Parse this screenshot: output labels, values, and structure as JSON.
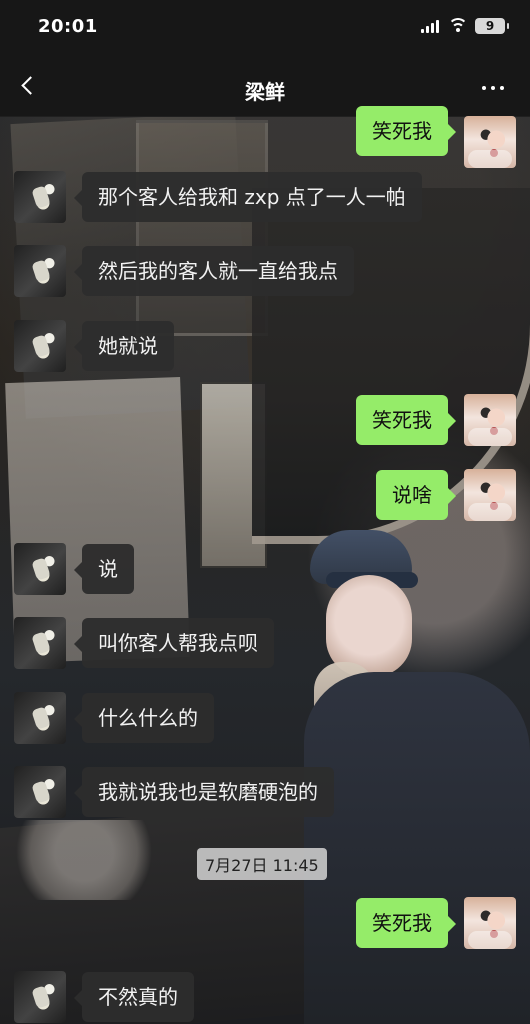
{
  "status_bar": {
    "time": "20:01",
    "battery": "9"
  },
  "nav": {
    "title": "梁鲜"
  },
  "messages": [
    {
      "side": "right",
      "text": "笑死我"
    },
    {
      "side": "left",
      "text": "那个客人给我和 zxp 点了一人一帕"
    },
    {
      "side": "left",
      "text": "然后我的客人就一直给我点"
    },
    {
      "side": "left",
      "text": "她就说"
    },
    {
      "side": "right",
      "text": "笑死我"
    },
    {
      "side": "right",
      "text": "说啥"
    },
    {
      "side": "left",
      "text": "说"
    },
    {
      "side": "left",
      "text": "叫你客人帮我点呗"
    },
    {
      "side": "left",
      "text": "什么什么的"
    },
    {
      "side": "left",
      "text": "我就说我也是软磨硬泡的"
    },
    {
      "side": "right",
      "text": "笑死我"
    },
    {
      "side": "left",
      "text": "不然真的"
    }
  ],
  "timestamp": "7月27日 11:45"
}
